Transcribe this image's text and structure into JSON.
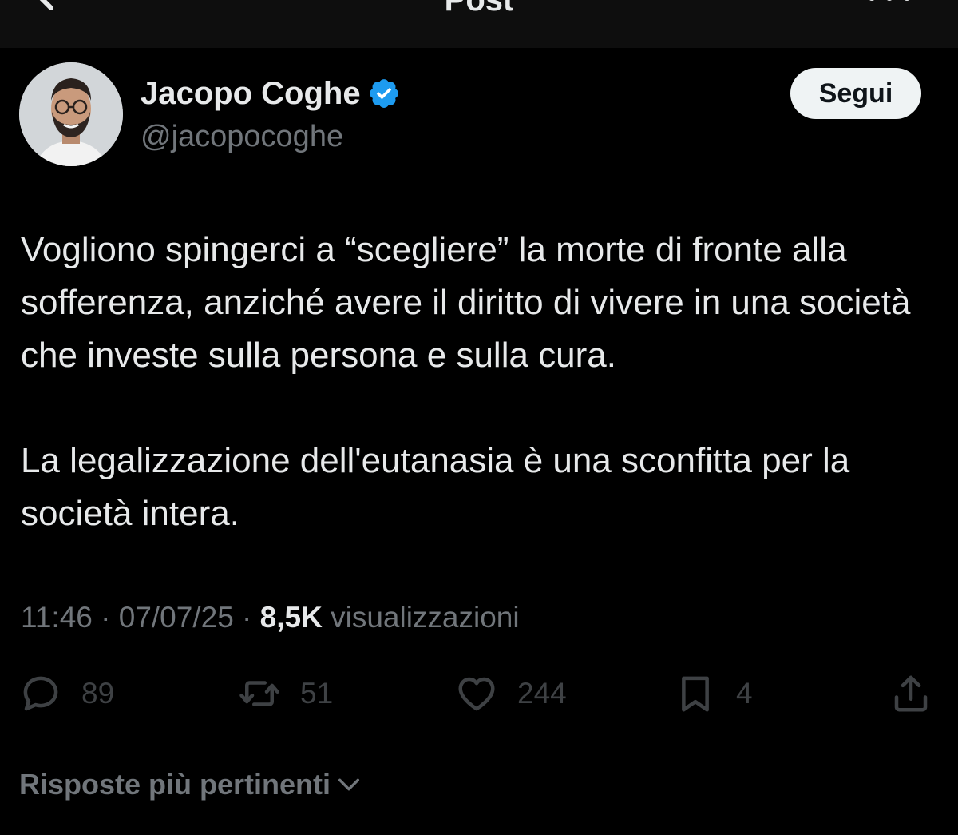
{
  "header": {
    "title": "Post",
    "back_icon": "arrow-left-icon",
    "more_icon": "more-horizontal-icon"
  },
  "author": {
    "name": "Jacopo Coghe",
    "handle": "@jacopocoghe",
    "verified": true,
    "verified_color": "#1d9bf0",
    "follow_label": "Segui"
  },
  "post": {
    "paragraphs": [
      "Vogliono spingerci a “scegliere” la morte di fronte alla sofferenza, anziché avere il diritto di vivere in una società che investe sulla persona e sulla cura.",
      "La legalizzazione dell'eutanasia è una sconfitta per la società intera."
    ],
    "time": "11:46",
    "separator": " · ",
    "date": "07/07/25",
    "views_count": "8,5K",
    "views_label": " visualizzazioni"
  },
  "actions": {
    "replies": "89",
    "reposts": "51",
    "likes": "244",
    "bookmarks": "4"
  },
  "replies_filter": {
    "label": "Risposte più pertinenti"
  }
}
